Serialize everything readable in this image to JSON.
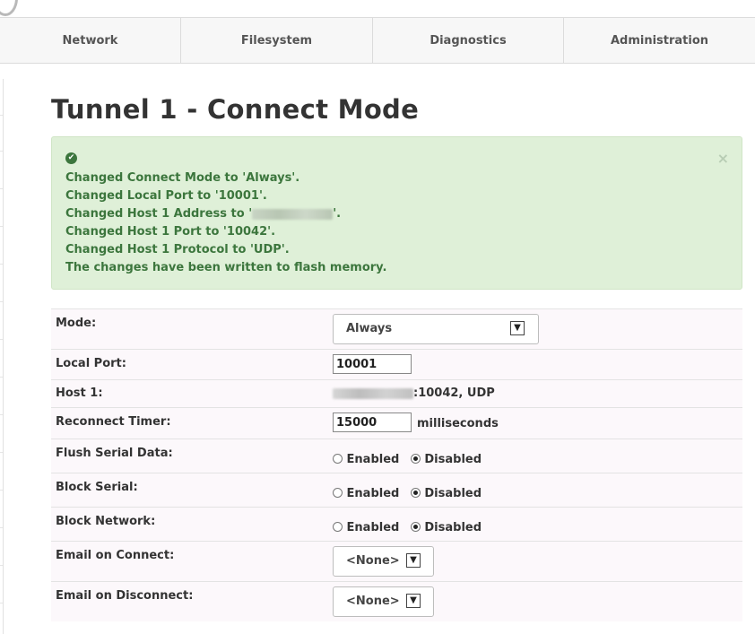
{
  "nav": {
    "tabs": [
      "Network",
      "Filesystem",
      "Diagnostics",
      "Administration"
    ]
  },
  "page_title": "Tunnel 1 - Connect Mode",
  "alert": {
    "messages": [
      {
        "prefix": "Changed Connect Mode to 'Always'.",
        "redacted": false
      },
      {
        "prefix": "Changed Local Port to '10001'.",
        "redacted": false
      },
      {
        "prefix": "Changed Host 1 Address to '",
        "redacted": true,
        "suffix": "'."
      },
      {
        "prefix": "Changed Host 1 Port to '10042'.",
        "redacted": false
      },
      {
        "prefix": "Changed Host 1 Protocol to 'UDP'.",
        "redacted": false
      },
      {
        "prefix": "The changes have been written to flash memory.",
        "redacted": false
      }
    ],
    "close_glyph": "×",
    "icon": "check-circle-icon"
  },
  "form": {
    "mode": {
      "label": "Mode:",
      "value": "Always"
    },
    "local_port": {
      "label": "Local Port:",
      "value": "10001"
    },
    "host1": {
      "label": "Host 1:",
      "value_suffix": ":10042, UDP"
    },
    "reconnect_timer": {
      "label": "Reconnect Timer:",
      "value": "15000",
      "unit": "milliseconds"
    },
    "flush_serial": {
      "label": "Flush Serial Data:",
      "enabled": "Enabled",
      "disabled": "Disabled",
      "selected": "Disabled"
    },
    "block_serial": {
      "label": "Block Serial:",
      "enabled": "Enabled",
      "disabled": "Disabled",
      "selected": "Disabled"
    },
    "block_network": {
      "label": "Block Network:",
      "enabled": "Enabled",
      "disabled": "Disabled",
      "selected": "Disabled"
    },
    "email_connect": {
      "label": "Email on Connect:",
      "value": "<None>"
    },
    "email_disconnect": {
      "label": "Email on Disconnect:",
      "value": "<None>"
    }
  }
}
